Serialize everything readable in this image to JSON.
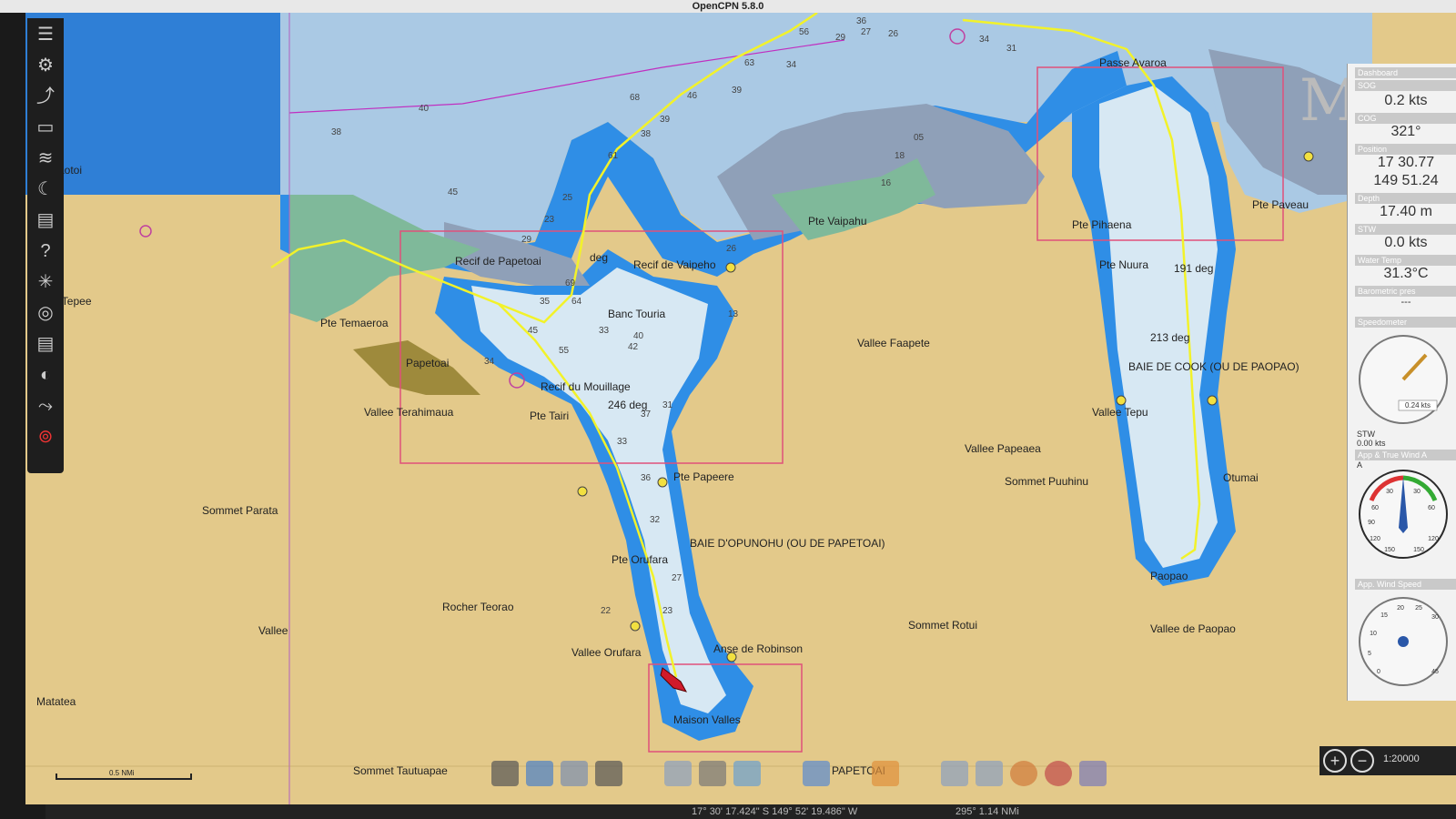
{
  "window": {
    "title": "OpenCPN 5.8.0"
  },
  "toolbar": {
    "icons": [
      "menu-icon",
      "settings-icon",
      "route-icon",
      "document-icon",
      "chart-icon",
      "tide-icon",
      "print-icon",
      "help-icon",
      "weather-icon",
      "ais-icon",
      "print-icon-2",
      "compass-icon",
      "track-icon",
      "lifebuoy-icon"
    ]
  },
  "places": {
    "taotoi": "Taotoi",
    "tepee": "e Tepee",
    "recif_papetoai": "Recif de Papetoai",
    "deg_label": "deg",
    "recif_vaipeho": "Recif de Vaipeho",
    "banc_touria": "Banc Touria",
    "pte_temaeroa": "Pte Temaeroa",
    "papetoai": "Papetoai",
    "vallee_terahimaua": "Vallee Terahimaua",
    "recif_mouillage": "Recif du Mouillage",
    "deg_246": "246 deg",
    "pte_tairi": "Pte Tairi",
    "pte_vaipahu": "Pte Vaipahu",
    "vallee_faapete": "Vallee Faapete",
    "pte_papeere": "Pte Papeere",
    "vallee_papeaea": "Vallee Papeaea",
    "sommet_puuhinu": "Sommet Puuhinu",
    "baie_opunohu": "BAIE D'OPUNOHU (OU DE PAPETOAI)",
    "sommet_parata": "Sommet Parata",
    "pte_orufara": "Pte Orufara",
    "rocher_teorao": "Rocher Teorao",
    "vallee": "Vallee",
    "vallee_orufara": "Vallee Orufara",
    "anse_robinson": "Anse de Robinson",
    "sommet_rotui": "Sommet Rotui",
    "matatea": "Matatea",
    "maison_valles": "Maison Valles",
    "sommet_tautuapae": "Sommet Tautuapae",
    "papetoai_bottom": "PAPETOAI",
    "passe_avaroa": "Passe Avaroa",
    "pte_pihaena": "Pte Pihaena",
    "pte_paveau": "Pte Paveau",
    "pte_nuura": "Pte Nuura",
    "deg_191": "191 deg",
    "deg_213": "213 deg",
    "baie_cook": "BAIE DE COOK (OU DE PAOPAO)",
    "vallee_tepu": "Vallee Tepu",
    "otumai": "Otumai",
    "paopao": "Paopao",
    "vallee_paopao": "Vallee de Paopao"
  },
  "depths": [
    "56",
    "29",
    "36",
    "27",
    "26",
    "34",
    "31",
    "63",
    "34",
    "68",
    "46",
    "39",
    "40",
    "38",
    "45",
    "61",
    "39",
    "38",
    "23",
    "25",
    "29",
    "35",
    "69",
    "64",
    "33",
    "42",
    "45",
    "55",
    "34",
    "40",
    "37",
    "31",
    "33",
    "36",
    "32",
    "27",
    "23",
    "22",
    "16",
    "18",
    "05",
    "26",
    "13"
  ],
  "dashboard": {
    "title": "Dashboard",
    "sog_label": "SOG",
    "sog_value": "0.2 kts",
    "cog_label": "COG",
    "cog_value": "321°",
    "position_label": "Position",
    "lat_value": "17 30.77",
    "lon_value": "149 51.24",
    "depth_label": "Depth",
    "depth_value": "17.40 m",
    "stw_label": "STW",
    "stw_value": "0.0 kts",
    "water_temp_label": "Water Temp",
    "water_temp_value": "31.3°C",
    "baro_label": "Barometric pres",
    "baro_value": "---",
    "speedometer_label": "Speedometer",
    "speed_readout": "0.24 kts",
    "stw_small_label": "STW",
    "stw_small_value": "0.00 kts",
    "wind_label": "App & True Wind A",
    "wind_a": "A",
    "wind_ticks": [
      "30",
      "30",
      "60",
      "60",
      "90",
      "120",
      "120",
      "150",
      "150"
    ],
    "wind_speed_label": "App. Wind Speed",
    "wind_speed_ticks": [
      "20",
      "25",
      "15",
      "30",
      "10",
      "5",
      "0",
      "45"
    ]
  },
  "watermark": "M",
  "scale": {
    "label": "0.5 NMi",
    "zoom_ratio": "1:20000"
  },
  "status": {
    "position": "17° 30' 17.424\" S   149° 52' 19.486\" W",
    "bearing": "295°  1.14 NMi"
  },
  "colors": {
    "land": "#e3c98a",
    "shallow": "#d7e8f3",
    "mid": "#a8c8e8",
    "deep": "#2f8ee6",
    "dark": "#8fa0b8",
    "track": "#f2f22a",
    "route": "#c02ec0"
  }
}
